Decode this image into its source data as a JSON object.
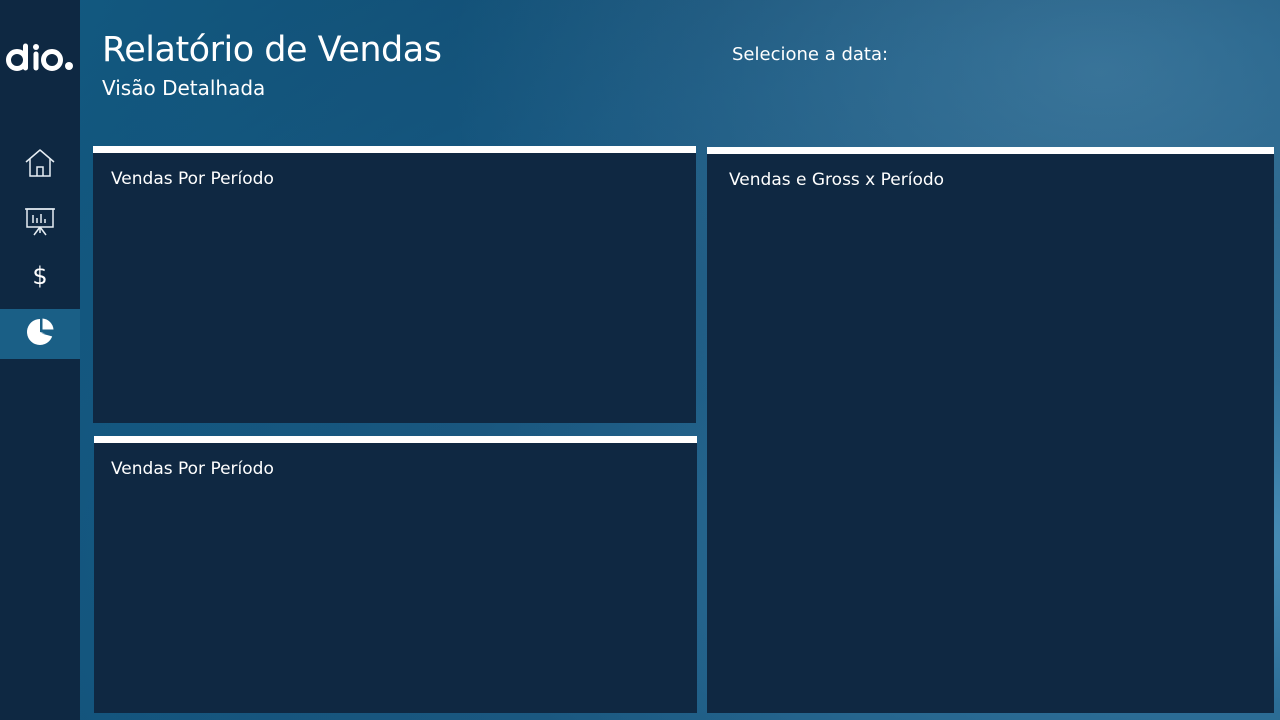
{
  "header": {
    "title": "Relatório de Vendas",
    "subtitle": "Visão Detalhada",
    "date_label": "Selecione a data:"
  },
  "sidebar": {
    "logo_text": "dio.",
    "items": [
      {
        "name": "home",
        "icon": "home-icon",
        "active": false
      },
      {
        "name": "presentation",
        "icon": "presentation-chart-icon",
        "active": false
      },
      {
        "name": "dollar",
        "icon": "dollar-icon",
        "symbol": "$",
        "active": false
      },
      {
        "name": "pie",
        "icon": "pie-chart-icon",
        "active": true
      }
    ]
  },
  "panels": [
    {
      "title": "Vendas Por Período"
    },
    {
      "title": "Vendas Por Período"
    },
    {
      "title": "Vendas e Gross x Período"
    }
  ],
  "colors": {
    "sidebar_bg": "#0e2842",
    "panel_bg": "#0f2842",
    "active_nav": "#1a5f86",
    "text": "#ffffff"
  }
}
